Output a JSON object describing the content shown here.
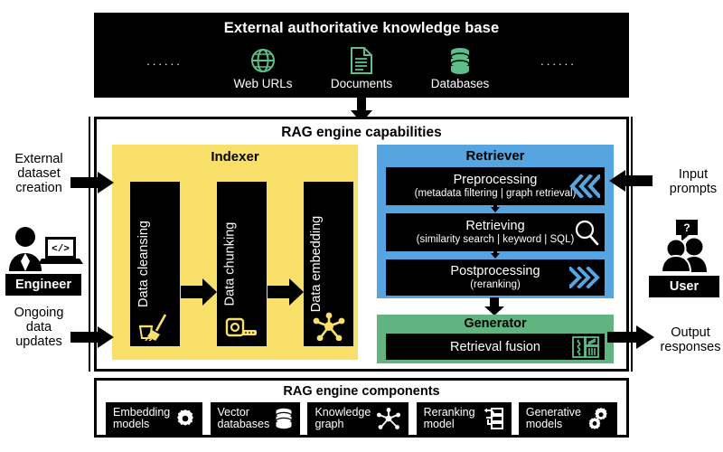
{
  "knowledge_base": {
    "title": "External authoritative knowledge base",
    "left_dots": "......",
    "right_dots": "......",
    "items": [
      {
        "label": "Web URLs",
        "icon": "globe-icon"
      },
      {
        "label": "Documents",
        "icon": "document-icon"
      },
      {
        "label": "Databases",
        "icon": "database-icon"
      }
    ],
    "icon_color": "#5CBF8A",
    "bg": "#000000"
  },
  "engine": {
    "title": "RAG engine capabilities",
    "indexer": {
      "title": "Indexer",
      "color": "#F9E06B",
      "steps": [
        {
          "label": "Data cleansing",
          "icon": "broom-bucket-icon"
        },
        {
          "label": "Data chunking",
          "icon": "paper-roll-icon"
        },
        {
          "label": "Data embedding",
          "icon": "node-graph-icon"
        }
      ]
    },
    "retriever": {
      "title": "Retriever",
      "color": "#56A5E0",
      "steps": [
        {
          "title": "Preprocessing",
          "subtitle": "(metadata filtering | graph retrieval)",
          "icon": "chevrons-left-icon"
        },
        {
          "title": "Retrieving",
          "subtitle": "(similarity search | keyword | SQL)",
          "icon": "magnifier-icon"
        },
        {
          "title": "Postprocessing",
          "subtitle": "(reranking)",
          "icon": "chevrons-right-icon"
        }
      ]
    },
    "generator": {
      "title": "Generator",
      "color": "#61B37F",
      "label": "Retrieval fusion",
      "icon": "fusion-icon"
    }
  },
  "components": {
    "title": "RAG engine components",
    "items": [
      {
        "line1": "Embedding",
        "line2": "models",
        "icon": "gear-icon"
      },
      {
        "line1": "Vector",
        "line2": "databases",
        "icon": "database-icon"
      },
      {
        "line1": "Knowledge",
        "line2": "graph",
        "icon": "knowledge-graph-icon"
      },
      {
        "line1": "Reranking",
        "line2": "model",
        "icon": "reranking-icon"
      },
      {
        "line1": "Generative",
        "line2": "models",
        "icon": "double-gear-icon"
      }
    ]
  },
  "actors": {
    "engineer": {
      "badge": "Engineer",
      "icon": "engineer-avatar-icon",
      "top_label": "External\ndataset\ncreation",
      "bottom_label": "Ongoing\ndata\nupdates"
    },
    "user": {
      "badge": "User",
      "icon": "user-avatar-icon",
      "top_label": "Input\nprompts",
      "bottom_label": "Output\nresponses"
    }
  }
}
